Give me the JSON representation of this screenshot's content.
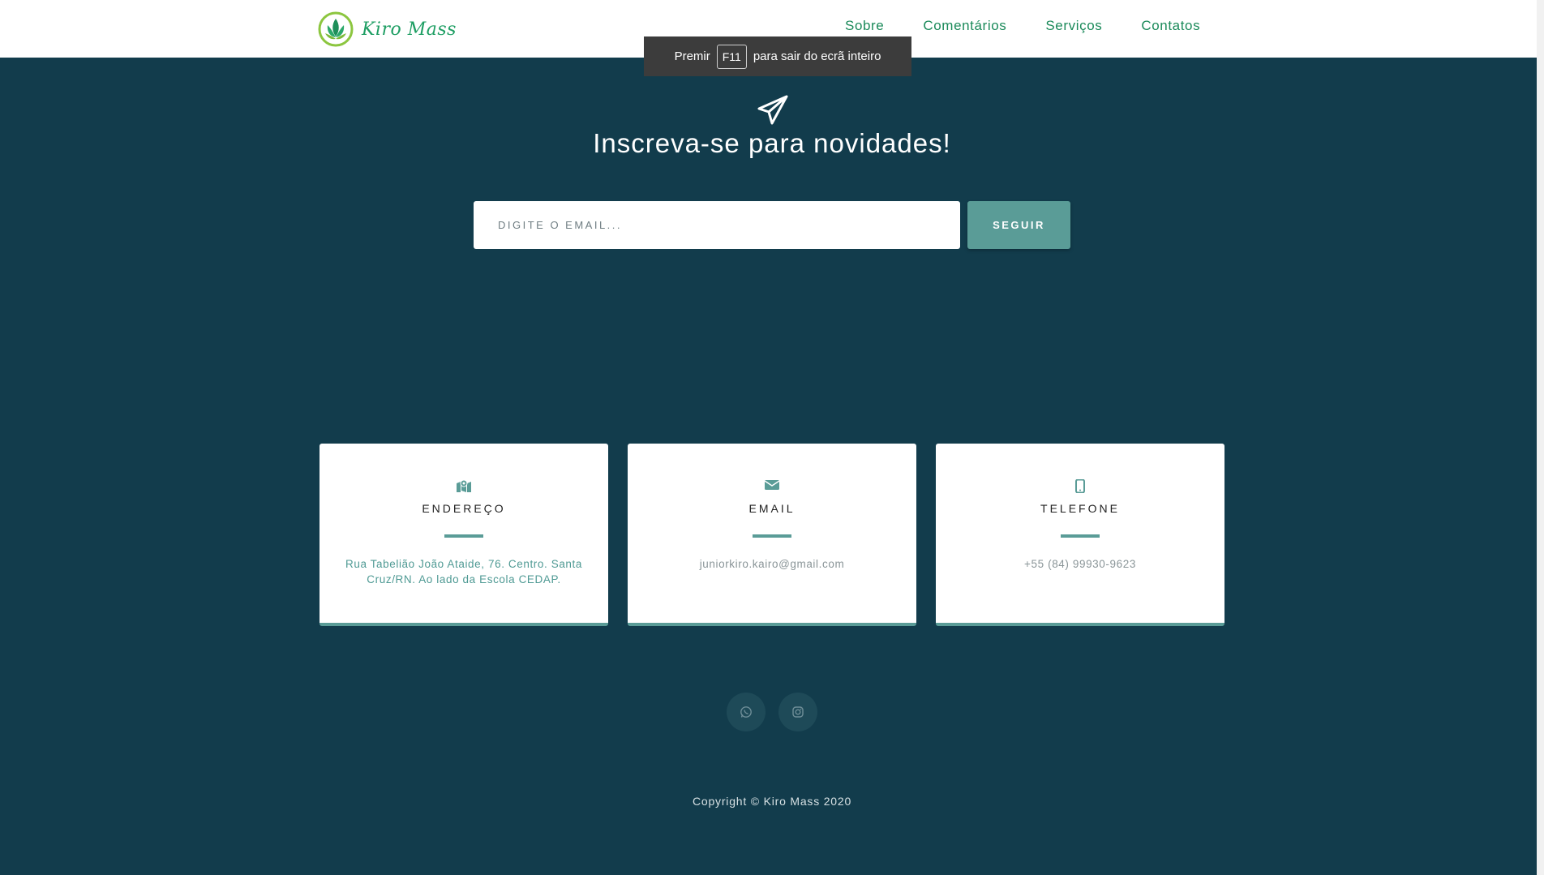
{
  "brand": {
    "name": "Kiro Mass"
  },
  "nav": {
    "links": [
      "Sobre",
      "Comentários",
      "Serviços",
      "Contatos"
    ]
  },
  "fullscreen_toast": {
    "before": "Premir",
    "key": "F11",
    "after": "para sair do ecrã inteiro"
  },
  "subscribe": {
    "headline": "Inscreva-se para novidades!",
    "placeholder": "DIGITE O EMAIL...",
    "button": "SEGUIR"
  },
  "cards": [
    {
      "title": "ENDEREÇO",
      "text": "Rua Tabelião João Ataide, 76. Centro. Santa Cruz/RN. Ao lado da Escola CEDAP.",
      "icon": "map-marked-icon"
    },
    {
      "title": "EMAIL",
      "text": "juniorkiro.kairo@gmail.com",
      "icon": "envelope-icon"
    },
    {
      "title": "TELEFONE",
      "text": "+55 (84) 99930-9623",
      "icon": "mobile-phone-icon"
    }
  ],
  "social": [
    "whatsapp-icon",
    "instagram-icon"
  ],
  "footer": {
    "copyright": "Copyright © Kiro Mass 2020"
  },
  "colors": {
    "background": "#123c4c",
    "accent": "#5a9c97",
    "nav_text": "#1b8a5a",
    "address_text": "#4f9a94",
    "muted_text": "#8a9598"
  }
}
